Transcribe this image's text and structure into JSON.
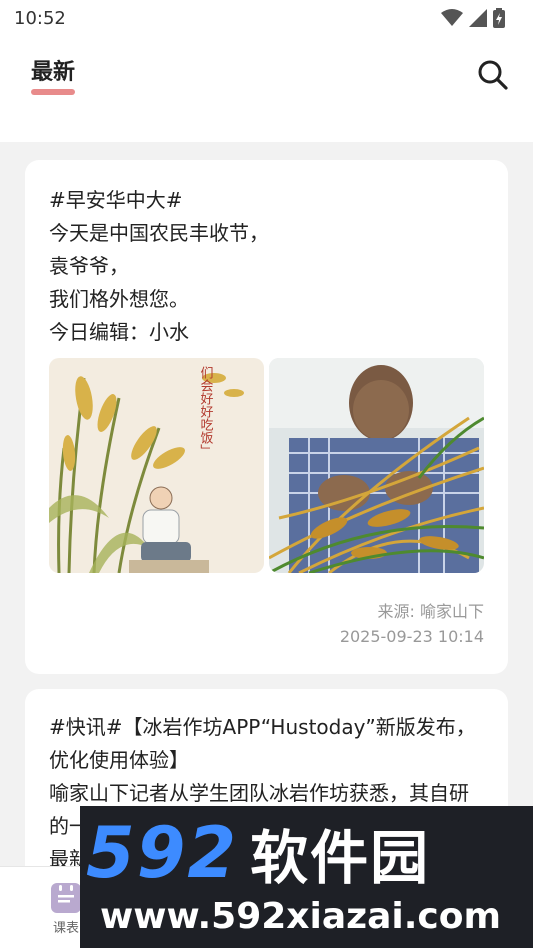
{
  "status_bar": {
    "time": "10:52"
  },
  "header": {
    "tab_label": "最新"
  },
  "posts": [
    {
      "lines": [
        "#早安华中大#",
        "今天是中国农民丰收节，",
        "袁爷爷，",
        "我们格外想您。",
        "今日编辑：小水"
      ],
      "source": "来源: 喻家山下",
      "time": "2025-09-23 10:14",
      "photo1_caption": "们会好好吃饭」"
    },
    {
      "lines": [
        "#快讯#【冰岩作坊APP“Hustoday”新版发布，",
        "优化使用体验】",
        "喻家山下记者从学生团队冰岩作坊获悉，其自研",
        "的一",
        "最新"
      ]
    }
  ],
  "bottom_nav": {
    "label": "课表"
  },
  "watermark": {
    "brand_number": "592",
    "brand_name": "软件园",
    "url": "www.592xiazai.com"
  },
  "colors": {
    "tab_underline": "#e88b8b",
    "watermark_blue": "#3d8bff",
    "watermark_bg": "#1e2026"
  }
}
